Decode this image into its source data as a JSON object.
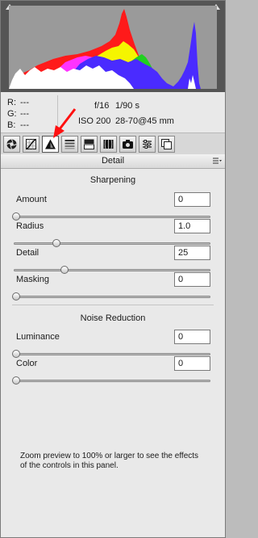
{
  "histogram": {
    "label": "Histogram",
    "colors": {
      "red": "#ff1a1a",
      "yellow": "#f5f500",
      "green": "#20d020",
      "blue": "#4a2bff",
      "cyan": "#28c8c8",
      "magenta": "#ff33ff",
      "white": "#ffffff"
    }
  },
  "readout": {
    "r_label": "R:",
    "r_value": "---",
    "g_label": "G:",
    "g_value": "---",
    "b_label": "B:",
    "b_value": "---",
    "aperture": "f/16",
    "shutter": "1/90 s",
    "iso": "ISO 200",
    "lens": "28-70@45 mm"
  },
  "tabs": {
    "items": [
      "basic",
      "tone-curve",
      "detail",
      "hsl",
      "split-toning",
      "lens-corrections",
      "camera-calibration",
      "presets",
      "snapshots"
    ],
    "active": "detail"
  },
  "panel": {
    "title": "Detail"
  },
  "sharpening": {
    "title": "Sharpening",
    "amount": {
      "label": "Amount",
      "value": "0",
      "fraction": 0.0
    },
    "radius": {
      "label": "Radius",
      "value": "1.0",
      "fraction": 0.21
    },
    "detail": {
      "label": "Detail",
      "value": "25",
      "fraction": 0.25
    },
    "masking": {
      "label": "Masking",
      "value": "0",
      "fraction": 0.0
    }
  },
  "noise_reduction": {
    "title": "Noise Reduction",
    "luminance": {
      "label": "Luminance",
      "value": "0",
      "fraction": 0.0
    },
    "color": {
      "label": "Color",
      "value": "0",
      "fraction": 0.0
    }
  },
  "note": "Zoom preview to 100% or larger to see the effects of the controls in this panel.",
  "accent": "#ff1010"
}
